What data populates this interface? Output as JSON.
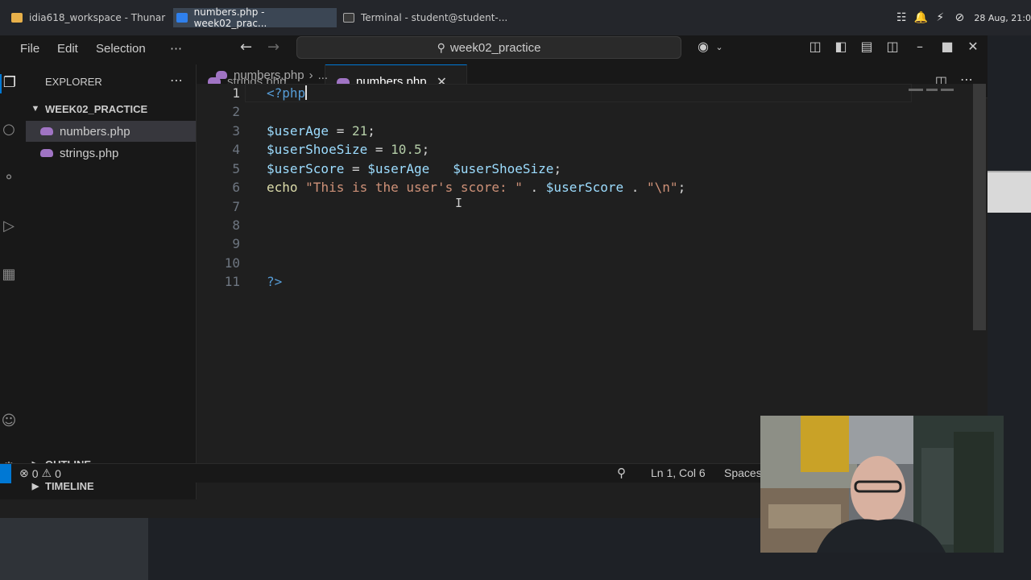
{
  "taskbar": {
    "tasks": [
      {
        "label": "idia618_workspace - Thunar"
      },
      {
        "label": "numbers.php - week02_prac..."
      },
      {
        "label": "Terminal - student@student-..."
      }
    ],
    "clock": "28 Aug, 21:0"
  },
  "titlebar": {
    "menu": [
      "File",
      "Edit",
      "Selection",
      "⋯"
    ],
    "command_center": "week02_practice"
  },
  "sidebar": {
    "title": "EXPLORER",
    "folder": "WEEK02_PRACTICE",
    "files": [
      "numbers.php",
      "strings.php"
    ],
    "outline": "OUTLINE",
    "timeline": "TIMELINE"
  },
  "tabs": [
    {
      "label": "strings.php"
    },
    {
      "label": "numbers.php"
    }
  ],
  "breadcrumb": {
    "file": "numbers.php",
    "more": "..."
  },
  "editor": {
    "line_numbers": [
      "1",
      "2",
      "3",
      "4",
      "5",
      "6",
      "7",
      "8",
      "9",
      "10",
      "11"
    ],
    "lines": {
      "l1": {
        "open": "<?php"
      },
      "l3": {
        "var": "$userAge",
        "eq": " = ",
        "num": "21",
        "end": ";"
      },
      "l4": {
        "var": "$userShoeSize",
        "eq": " = ",
        "num": "10.5",
        "end": ";"
      },
      "l5": {
        "var": "$userScore",
        "eq": " = ",
        "var2": "$userAge",
        "gap": "   ",
        "var3": "$userShoeSize",
        "end": ";"
      },
      "l6": {
        "kw": "echo",
        "sp": " ",
        "str1": "\"This is the user's score: \"",
        "dot1": " . ",
        "var": "$userScore",
        "dot2": " . ",
        "str2": "\"\\n\"",
        "end": ";"
      },
      "l11": {
        "close": "?>"
      }
    },
    "ibeam": "I"
  },
  "statusbar": {
    "errors": "0",
    "warnings": "0",
    "cursor": "Ln 1, Col 6",
    "spaces": "Spaces"
  },
  "colors": {
    "accent": "#0078d4",
    "php_icon": "#a074c4",
    "string": "#ce9178",
    "variable": "#9cdcfe",
    "number": "#b5cea8",
    "tag": "#569cd6"
  }
}
